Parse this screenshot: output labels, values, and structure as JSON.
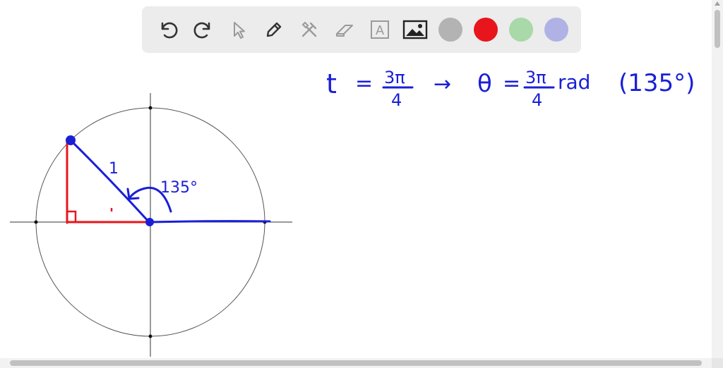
{
  "toolbar": {
    "tools": [
      {
        "name": "undo-icon"
      },
      {
        "name": "redo-icon"
      },
      {
        "name": "select-pointer-icon"
      },
      {
        "name": "pen-icon"
      },
      {
        "name": "tools-icon"
      },
      {
        "name": "eraser-icon"
      },
      {
        "name": "text-icon",
        "glyph": "A"
      },
      {
        "name": "image-icon"
      }
    ],
    "colors": [
      "#b3b3b3",
      "#e8151c",
      "#a9d8a9",
      "#b0b2e6"
    ]
  },
  "note": {
    "t": "t",
    "eq1": "=",
    "num1": "3π",
    "den1": "4",
    "arrow": "→",
    "theta": "θ",
    "eq2": "=",
    "num2": "3π",
    "den2": "4",
    "unit": "rad",
    "deg": "(135°)"
  },
  "drawing": {
    "hyp_label": "1",
    "angle_label": "135°"
  }
}
